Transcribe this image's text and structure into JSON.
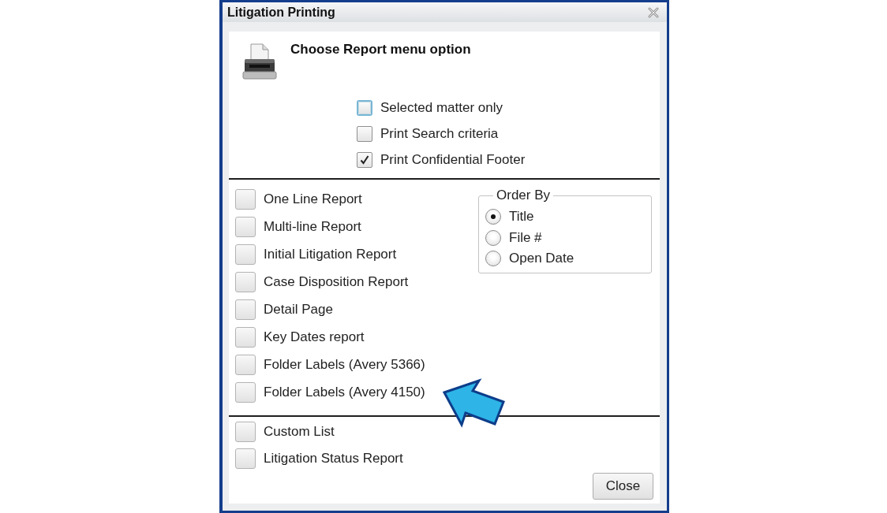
{
  "window": {
    "title": "Litigation Printing"
  },
  "header": {
    "heading": "Choose Report menu option"
  },
  "options": [
    {
      "label": "Selected matter only",
      "checked": false,
      "focused": true
    },
    {
      "label": "Print Search criteria",
      "checked": false,
      "focused": false
    },
    {
      "label": "Print Confidential Footer",
      "checked": true,
      "focused": false
    }
  ],
  "reports": [
    {
      "label": "One Line Report",
      "pointed_at": false
    },
    {
      "label": "Multi-line Report",
      "pointed_at": false
    },
    {
      "label": "Initial Litigation Report",
      "pointed_at": false
    },
    {
      "label": "Case Disposition Report",
      "pointed_at": false
    },
    {
      "label": "Detail Page",
      "pointed_at": false
    },
    {
      "label": "Key Dates report",
      "pointed_at": false
    },
    {
      "label": "Folder Labels (Avery 5366)",
      "pointed_at": false
    },
    {
      "label": "Folder Labels (Avery 4150)",
      "pointed_at": true
    }
  ],
  "order_by": {
    "legend": "Order By",
    "choices": [
      {
        "label": "Title",
        "selected": true
      },
      {
        "label": "File #",
        "selected": false
      },
      {
        "label": "Open Date",
        "selected": false
      }
    ]
  },
  "other_reports": [
    {
      "label": "Custom List",
      "pointed_at": false
    },
    {
      "label": "Litigation Status Report",
      "pointed_at": false
    }
  ],
  "buttons": [
    {
      "label": "Close"
    }
  ]
}
